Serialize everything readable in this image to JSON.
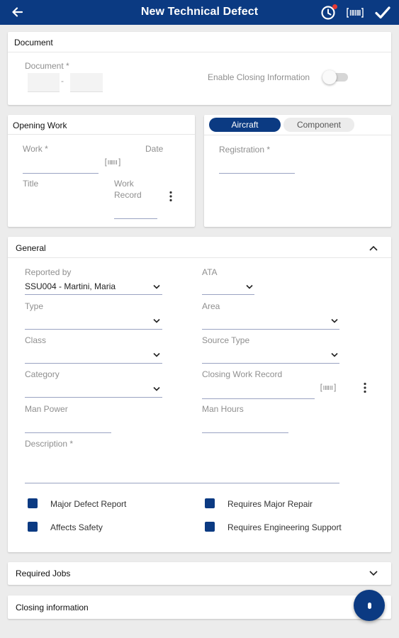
{
  "appbar": {
    "title": "New Technical Defect",
    "colors": {
      "primary": "#0b3a82",
      "notification_dot": "#e53935"
    },
    "icons": [
      "arrow-back-icon",
      "history-clock-icon",
      "barcode-icon",
      "checkmark-icon"
    ]
  },
  "document": {
    "title": "Document",
    "document_label": "Document *",
    "separator": "-",
    "enable_closing_label": "Enable Closing Information",
    "enable_closing_on": false
  },
  "opening_work": {
    "title": "Opening Work",
    "work_label": "Work *",
    "date_label": "Date",
    "title_label": "Title",
    "work_record_label": "Work Record"
  },
  "target": {
    "tabs": [
      {
        "label": "Aircraft",
        "selected": true
      },
      {
        "label": "Component",
        "selected": false
      }
    ],
    "registration_label": "Registration *"
  },
  "general": {
    "title": "General",
    "reported_by_label": "Reported by",
    "reported_by_value": "SSU004 - Martini, Maria",
    "ata_label": "ATA",
    "type_label": "Type",
    "area_label": "Area",
    "class_label": "Class",
    "source_type_label": "Source Type",
    "category_label": "Category",
    "closing_work_record_label": "Closing Work Record",
    "man_power_label": "Man Power",
    "man_hours_label": "Man Hours",
    "description_label": "Description *",
    "checkboxes": [
      {
        "label": "Major Defect Report"
      },
      {
        "label": "Requires Major Repair"
      },
      {
        "label": "Affects Safety"
      },
      {
        "label": "Requires Engineering Support"
      }
    ]
  },
  "required_jobs": {
    "title": "Required Jobs"
  },
  "closing_information": {
    "title": "Closing information"
  }
}
